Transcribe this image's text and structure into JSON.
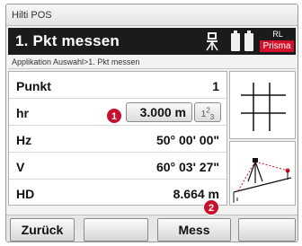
{
  "window": {
    "title": "Hilti POS"
  },
  "app_bar": {
    "title": "1. Pkt messen",
    "mode": "RL",
    "target": "Prisma",
    "icons": [
      "tripod-icon",
      "battery-icon",
      "battery-icon"
    ]
  },
  "breadcrumb": "Applikation Auswahl>1. Pkt messen",
  "fields": [
    {
      "label": "Punkt",
      "value": "1"
    },
    {
      "label": "hr",
      "value": "3.000 m",
      "keypad": "123"
    },
    {
      "label": "Hz",
      "value": "50° 00' 00\""
    },
    {
      "label": "V",
      "value": "60° 03' 27\""
    },
    {
      "label": "HD",
      "value": "8.664 m"
    }
  ],
  "badges": [
    "1",
    "2"
  ],
  "footer": {
    "back_label": "Zurück",
    "measure_label": "Mess"
  },
  "colors": {
    "accent_red": "#d4112b",
    "bar": "#1b1b1b"
  }
}
